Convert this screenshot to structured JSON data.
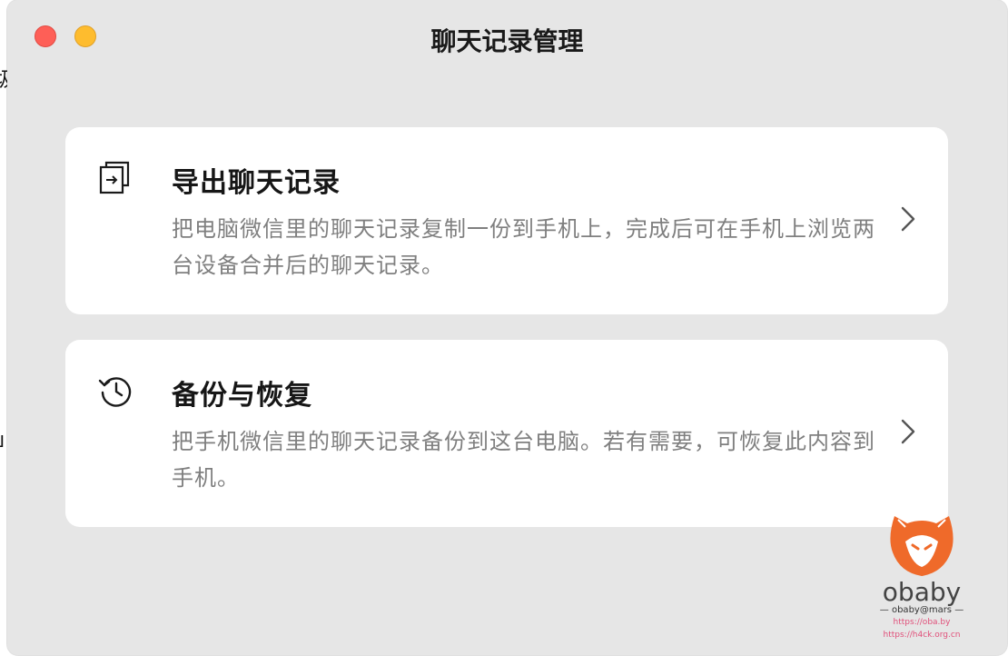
{
  "background": {
    "glyph_top": "圾",
    "glyph_mid": "ᒧ"
  },
  "window": {
    "title": "聊天记录管理"
  },
  "cards": [
    {
      "icon": "export-icon",
      "title": "导出聊天记录",
      "description": "把电脑微信里的聊天记录复制一份到手机上，完成后可在手机上浏览两台设备合并后的聊天记录。"
    },
    {
      "icon": "history-clock-icon",
      "title": "备份与恢复",
      "description": "把手机微信里的聊天记录备份到这台电脑。若有需要，可恢复此内容到手机。"
    }
  ],
  "watermark": {
    "name": "obaby",
    "handle": "obaby@mars",
    "url1": "https://oba.by",
    "url2": "https://h4ck.org.cn"
  },
  "colors": {
    "window_bg": "#e6e6e6",
    "card_bg": "#ffffff",
    "close": "#fe5f57",
    "minimize": "#febc2e",
    "watermark_orange": "#ef6a2a"
  }
}
